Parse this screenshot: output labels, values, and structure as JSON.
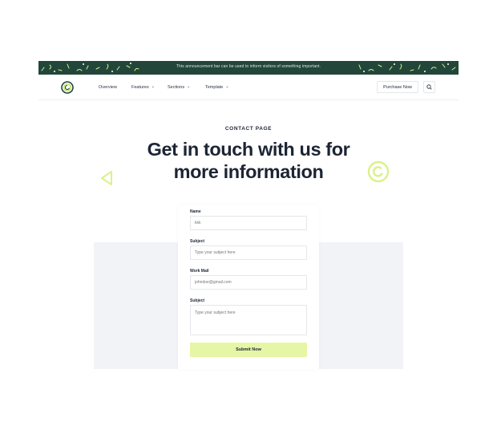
{
  "announcement": {
    "text": "This announcement bar can be used to inform visitors of something important."
  },
  "nav": {
    "links": [
      {
        "label": "Overview",
        "dropdown": false
      },
      {
        "label": "Features",
        "dropdown": true
      },
      {
        "label": "Sections",
        "dropdown": true
      },
      {
        "label": "Template",
        "dropdown": true
      }
    ],
    "purchase_label": "Purchase Now"
  },
  "hero": {
    "eyebrow": "CONTACT PAGE",
    "headline_line1": "Get in touch with us for",
    "headline_line2": "more information"
  },
  "form": {
    "fields": [
      {
        "label": "Name",
        "placeholder": "kkk"
      },
      {
        "label": "Subject",
        "placeholder": "Type your subject here"
      },
      {
        "label": "Work Mail",
        "placeholder": "johndoe@gmail.com"
      },
      {
        "label": "Subject",
        "placeholder": "Type your subject here"
      }
    ],
    "submit_label": "Submit Now"
  },
  "colors": {
    "announcement_bg": "#22463a",
    "accent_lime": "#e5f7a6",
    "decor_lime": "#d9f28a",
    "text_dark": "#1c2434"
  },
  "icons": [
    "logo-icon",
    "chevron-down-icon",
    "search-icon",
    "triangle-decor-icon",
    "spiral-decor-icon"
  ]
}
